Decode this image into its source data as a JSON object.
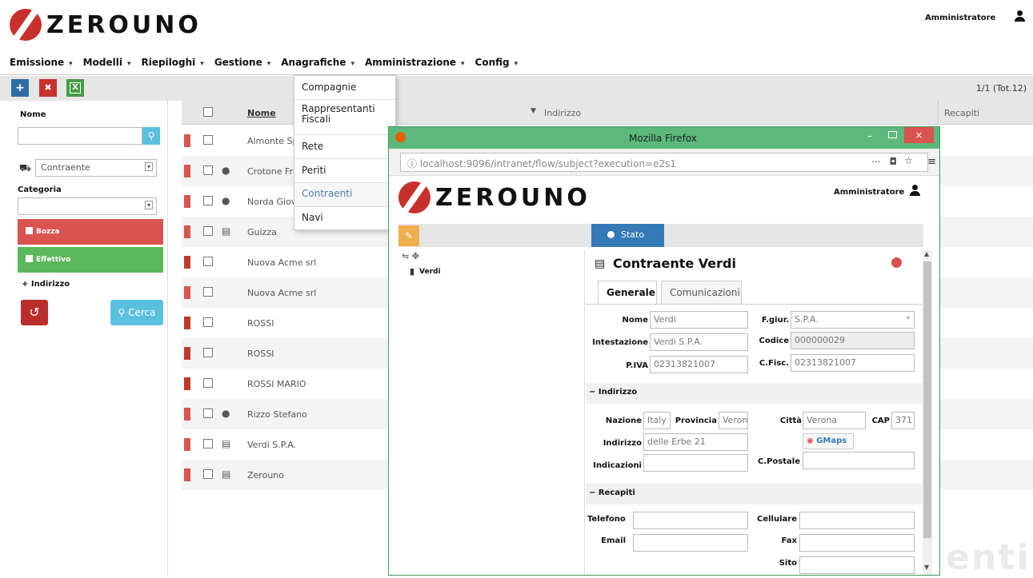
{
  "header": {
    "logo_text": "ZEROUNO",
    "user_name": "Amministratore"
  },
  "menu": [
    {
      "label": "Emissione"
    },
    {
      "label": "Modelli"
    },
    {
      "label": "Riepiloghi"
    },
    {
      "label": "Gestione"
    },
    {
      "label": "Anagrafiche"
    },
    {
      "label": "Amministrazione"
    },
    {
      "label": "Config"
    }
  ],
  "toolbar": {
    "add": "+",
    "delete": "✖",
    "export": "X",
    "pager": "1/1 (Tot.12)"
  },
  "sidebar": {
    "nome_label": "Nome",
    "subject_type": "Contraente",
    "categoria_label": "Categoria",
    "bozza_label": "Bozza",
    "effettivo_label": "Effettivo",
    "indirizzo_label": "+ Indirizzo",
    "search_label": "Cerca",
    "colors": {
      "bozza": "#d9534f",
      "effettivo": "#5cb85c",
      "search": "#5bc0de",
      "reset": "#b92d2a"
    }
  },
  "table": {
    "headers": {
      "nome": "Nome",
      "indirizzo": "Indirizzo",
      "recapiti": "Recapiti"
    },
    "rows": [
      {
        "name": "Almonte Sp",
        "icon": "",
        "mark": "red"
      },
      {
        "name": "Crotone Fra",
        "icon": "person",
        "mark": "red"
      },
      {
        "name": "Norda Giov",
        "icon": "person",
        "mark": "red"
      },
      {
        "name": "Guizza",
        "icon": "building",
        "mark": "red"
      },
      {
        "name": "Nuova Acme srl",
        "icon": "",
        "mark": "dark"
      },
      {
        "name": "Nuova Acme srl",
        "icon": "",
        "mark": "red"
      },
      {
        "name": "ROSSI",
        "icon": "",
        "mark": "dark"
      },
      {
        "name": "ROSSI",
        "icon": "",
        "mark": "dark"
      },
      {
        "name": "ROSSI MARIO",
        "icon": "",
        "mark": "dark"
      },
      {
        "name": "Rizzo Stefano",
        "icon": "person",
        "mark": "red"
      },
      {
        "name": "Verdi S.P.A.",
        "icon": "building",
        "mark": "red"
      },
      {
        "name": "Zerouno",
        "icon": "building",
        "mark": "red"
      }
    ]
  },
  "dropdown": {
    "items": [
      "Compagnie",
      "Rappresentanti Fiscali",
      "Rete",
      "Periti",
      "Contraenti",
      "Navi"
    ]
  },
  "firefox": {
    "title": "Mozilla Firefox",
    "url": "localhost:9096/intranet/flow/subject?execution=e2s1",
    "logo_text": "ZEROUNO",
    "user_name": "Amministratore",
    "stato_tab": "Stato",
    "tree_node": "Verdi",
    "record_title": "Contraente Verdi",
    "tabs": [
      "Generale",
      "Comunicazioni"
    ],
    "form": {
      "nome_label": "Nome",
      "nome": "Verdi",
      "fgiur_label": "F.giur.",
      "fgiur": "S.P.A.",
      "intestazione_label": "Intestazione",
      "intestazione": "Verdi S.P.A.",
      "codice_label": "Codice",
      "codice": "000000029",
      "piva_label": "P.IVA",
      "piva": "02313821007",
      "cfisc_label": "C.Fisc.",
      "cfisc": "02313821007",
      "indirizzo_section": "− Indirizzo",
      "nazione_label": "Nazione",
      "nazione": "Italy",
      "provincia_label": "Provincia",
      "provincia": "Veron",
      "citta_label": "Città",
      "citta": "Verona",
      "cap_label": "CAP",
      "cap": "371",
      "indirizzo_label": "Indirizzo",
      "indirizzo": "delle Erbe 21",
      "gmaps_label": "GMaps",
      "indicazioni_label": "Indicazioni",
      "cpostale_label": "C.Postale",
      "recapiti_section": "− Recapiti",
      "telefono_label": "Telefono",
      "cellulare_label": "Cellulare",
      "email_label": "Email",
      "fax_label": "Fax",
      "sito_label": "Sito"
    }
  },
  "watermark": "enti"
}
